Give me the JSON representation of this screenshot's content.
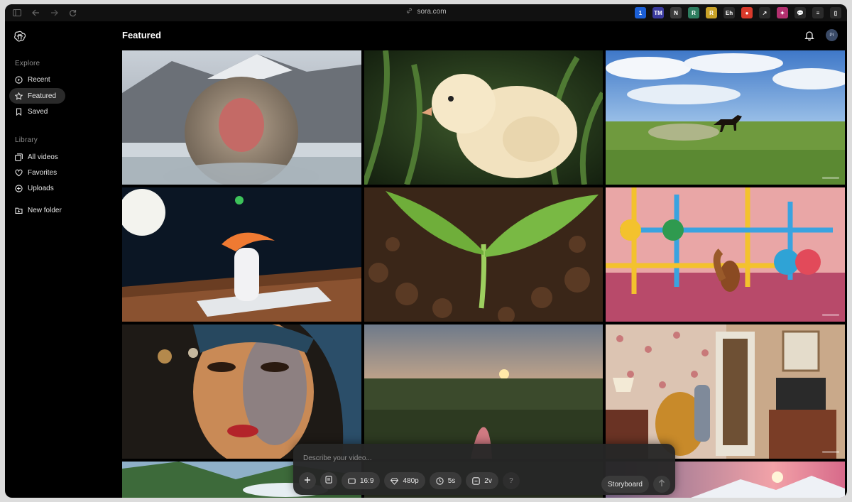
{
  "browser": {
    "url": "sora.com",
    "extensions": [
      {
        "icon": "1password-icon",
        "label": "1",
        "color": "#1b5fd6"
      },
      {
        "icon": "tampermonkey-icon",
        "label": "TM",
        "color": "#3a3a9e"
      },
      {
        "icon": "notion-icon",
        "label": "N",
        "color": "#3b3b3b"
      },
      {
        "icon": "green-square-icon",
        "label": "R",
        "color": "#2d7d5f"
      },
      {
        "icon": "r-extension-icon",
        "label": "R",
        "color": "#c9a227"
      },
      {
        "icon": "eh-icon",
        "label": "Eh",
        "color": "#2a2a2a"
      },
      {
        "icon": "red-circle-icon",
        "label": "●",
        "color": "#d93a2b"
      },
      {
        "icon": "chart-icon",
        "label": "↗",
        "color": "#2a2a2a"
      },
      {
        "icon": "pink-extension-icon",
        "label": "✦",
        "color": "#b3306f"
      },
      {
        "icon": "chat-icon",
        "label": "💬",
        "color": "#2a2a2a"
      },
      {
        "icon": "notes-icon",
        "label": "≡",
        "color": "#2a2a2a"
      },
      {
        "icon": "sidebar-icon",
        "label": "▯",
        "color": "#2a2a2a"
      }
    ]
  },
  "sidebar": {
    "explore_label": "Explore",
    "explore_items": [
      {
        "label": "Recent",
        "icon": "clock-icon"
      },
      {
        "label": "Featured",
        "icon": "star-icon",
        "active": true
      },
      {
        "label": "Saved",
        "icon": "bookmark-icon"
      }
    ],
    "library_label": "Library",
    "library_items": [
      {
        "label": "All videos",
        "icon": "videos-icon"
      },
      {
        "label": "Favorites",
        "icon": "heart-icon"
      },
      {
        "label": "Uploads",
        "icon": "upload-icon"
      }
    ],
    "new_folder_label": "New folder"
  },
  "header": {
    "title": "Featured",
    "avatar_initials": "PI"
  },
  "prompt": {
    "placeholder": "Describe your video...",
    "aspect_ratio": "16:9",
    "resolution": "480p",
    "duration": "5s",
    "variations": "2v",
    "help": "?",
    "storyboard_label": "Storyboard"
  },
  "accent_colors": {
    "background": "#000000",
    "active_nav": "#2a2a2a",
    "prompt_bg": "#262626"
  }
}
